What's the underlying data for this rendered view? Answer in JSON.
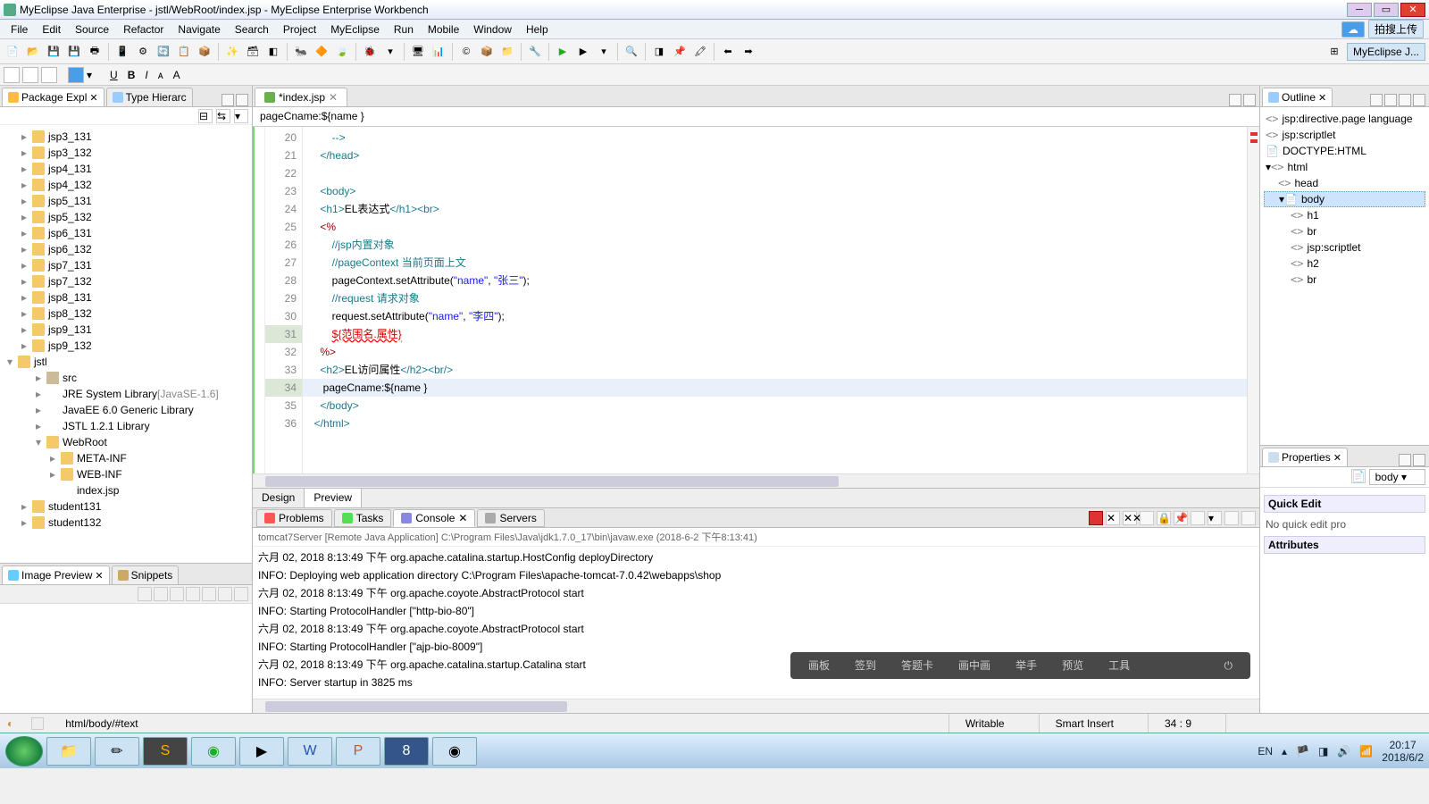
{
  "window": {
    "title": "MyEclipse Java Enterprise - jstl/WebRoot/index.jsp - MyEclipse Enterprise Workbench",
    "perspective_upload": "拍搜上传",
    "perspective_label": "MyEclipse J..."
  },
  "menu": [
    "File",
    "Edit",
    "Source",
    "Refactor",
    "Navigate",
    "Search",
    "Project",
    "MyEclipse",
    "Run",
    "Mobile",
    "Window",
    "Help"
  ],
  "package_explorer": {
    "tab": "Package Expl",
    "tab2": "Type Hierarc",
    "items": [
      {
        "l": "jsp3_131",
        "t": "folder",
        "i": 1
      },
      {
        "l": "jsp3_132",
        "t": "folder",
        "i": 1
      },
      {
        "l": "jsp4_131",
        "t": "folder",
        "i": 1
      },
      {
        "l": "jsp4_132",
        "t": "folder",
        "i": 1
      },
      {
        "l": "jsp5_131",
        "t": "folder",
        "i": 1
      },
      {
        "l": "jsp5_132",
        "t": "folder",
        "i": 1
      },
      {
        "l": "jsp6_131",
        "t": "folder",
        "i": 1
      },
      {
        "l": "jsp6_132",
        "t": "folder",
        "i": 1
      },
      {
        "l": "jsp7_131",
        "t": "folder",
        "i": 1
      },
      {
        "l": "jsp7_132",
        "t": "folder",
        "i": 1
      },
      {
        "l": "jsp8_131",
        "t": "folder",
        "i": 1
      },
      {
        "l": "jsp8_132",
        "t": "folder",
        "i": 1
      },
      {
        "l": "jsp9_131",
        "t": "folder",
        "i": 1
      },
      {
        "l": "jsp9_132",
        "t": "folder",
        "i": 1
      },
      {
        "l": "jstl",
        "t": "project",
        "i": 0,
        "exp": true
      },
      {
        "l": "src",
        "t": "pkg",
        "i": 2
      },
      {
        "l": "JRE System Library",
        "suffix": "[JavaSE-1.6]",
        "t": "lib",
        "i": 2
      },
      {
        "l": "JavaEE 6.0 Generic Library",
        "t": "lib",
        "i": 2
      },
      {
        "l": "JSTL 1.2.1 Library",
        "t": "lib",
        "i": 2
      },
      {
        "l": "WebRoot",
        "t": "folder",
        "i": 2,
        "exp": true
      },
      {
        "l": "META-INF",
        "t": "folder",
        "i": 3
      },
      {
        "l": "WEB-INF",
        "t": "folder",
        "i": 3
      },
      {
        "l": "index.jsp",
        "t": "file",
        "i": 3
      },
      {
        "l": "student131",
        "t": "folder",
        "i": 1
      },
      {
        "l": "student132",
        "t": "folder",
        "i": 1
      }
    ]
  },
  "image_preview": {
    "tab": "Image Preview",
    "tab2": "Snippets"
  },
  "editor": {
    "tab": "*index.jsp",
    "breadcrumb": "pageCname:${name }",
    "lines": [
      {
        "n": 20,
        "html": "        <span class='tag'>--&gt;</span>"
      },
      {
        "n": 21,
        "html": "    <span class='tag'>&lt;/head&gt;</span>"
      },
      {
        "n": 22,
        "html": ""
      },
      {
        "n": 23,
        "html": "    <span class='tag'>&lt;body&gt;</span>"
      },
      {
        "n": 24,
        "html": "    <span class='tag'>&lt;h1&gt;</span>EL表达式<span class='tag'>&lt;/h1&gt;&lt;br&gt;</span>"
      },
      {
        "n": 25,
        "html": "    <span class='kw'>&lt;%</span>"
      },
      {
        "n": 26,
        "html": "        <span class='cmt'>//jsp内置对象</span>"
      },
      {
        "n": 27,
        "html": "        <span class='cmt'>//pageContext</span> <span class='cmt'>当前页面上文</span>"
      },
      {
        "n": 28,
        "html": "        pageContext.setAttribute(<span class='str'>\"name\"</span>, <span class='str'>\"张三\"</span>);"
      },
      {
        "n": 29,
        "html": "        <span class='cmt'>//request</span> <span class='cmt'>请求对象</span>"
      },
      {
        "n": 30,
        "html": "        request.setAttribute(<span class='str'>\"name\"</span>, <span class='str'>\"李四\"</span>);"
      },
      {
        "n": 31,
        "html": "        <span class='err'>${范围名.属性}</span>",
        "warn": true
      },
      {
        "n": 32,
        "html": "    <span class='kw'>%&gt;</span>"
      },
      {
        "n": 33,
        "html": "    <span class='tag'>&lt;h2&gt;</span>EL访问属性<span class='tag'>&lt;/h2&gt;&lt;br/&gt;</span>"
      },
      {
        "n": 34,
        "html": "     pageCname:${name }",
        "hl": true,
        "warn": true
      },
      {
        "n": 35,
        "html": "    <span class='tag'>&lt;/body&gt;</span>"
      },
      {
        "n": 36,
        "html": "  <span class='tag'>&lt;/html&gt;</span>"
      }
    ],
    "bottom_tabs": {
      "design": "Design",
      "preview": "Preview"
    }
  },
  "bottom": {
    "tabs": {
      "problems": "Problems",
      "tasks": "Tasks",
      "console": "Console",
      "servers": "Servers"
    },
    "console_desc": "tomcat7Server [Remote Java Application] C:\\Program Files\\Java\\jdk1.7.0_17\\bin\\javaw.exe (2018-6-2 下午8:13:41)",
    "lines": [
      "六月 02, 2018 8:13:49 下午 org.apache.catalina.startup.HostConfig deployDirectory",
      "INFO: Deploying web application directory C:\\Program Files\\apache-tomcat-7.0.42\\webapps\\shop",
      "六月 02, 2018 8:13:49 下午 org.apache.coyote.AbstractProtocol start",
      "INFO: Starting ProtocolHandler [\"http-bio-80\"]",
      "六月 02, 2018 8:13:49 下午 org.apache.coyote.AbstractProtocol start",
      "INFO: Starting ProtocolHandler [\"ajp-bio-8009\"]",
      "六月 02, 2018 8:13:49 下午 org.apache.catalina.startup.Catalina start",
      "INFO: Server startup in 3825 ms"
    ],
    "overlay": [
      "画板",
      "签到",
      "答题卡",
      "画中画",
      "举手",
      "预览",
      "工具"
    ]
  },
  "outline": {
    "tab": "Outline",
    "items": [
      {
        "l": "jsp:directive.page language",
        "i": 0,
        "ic": "<>"
      },
      {
        "l": "jsp:scriptlet",
        "i": 0,
        "ic": "<>"
      },
      {
        "l": "DOCTYPE:HTML",
        "i": 0,
        "ic": "📄"
      },
      {
        "l": "html",
        "i": 0,
        "ic": "<>",
        "exp": true
      },
      {
        "l": "head",
        "i": 1,
        "ic": "<>"
      },
      {
        "l": "body",
        "i": 1,
        "ic": "📄",
        "exp": true,
        "sel": true
      },
      {
        "l": "h1",
        "i": 2,
        "ic": "<>"
      },
      {
        "l": "br",
        "i": 2,
        "ic": "<>"
      },
      {
        "l": "jsp:scriptlet",
        "i": 2,
        "ic": "<>"
      },
      {
        "l": "h2",
        "i": 2,
        "ic": "<>"
      },
      {
        "l": "br",
        "i": 2,
        "ic": "<>"
      }
    ]
  },
  "properties": {
    "tab": "Properties",
    "selector": "body",
    "no_quick": "No quick edit pro",
    "quick_edit": "Quick Edit",
    "attributes": "Attributes"
  },
  "status": {
    "path": "html/body/#text",
    "writable": "Writable",
    "insert": "Smart Insert",
    "pos": "34 : 9"
  },
  "tray": {
    "ime": "EN",
    "time": "20:17",
    "date": "2018/6/2"
  }
}
